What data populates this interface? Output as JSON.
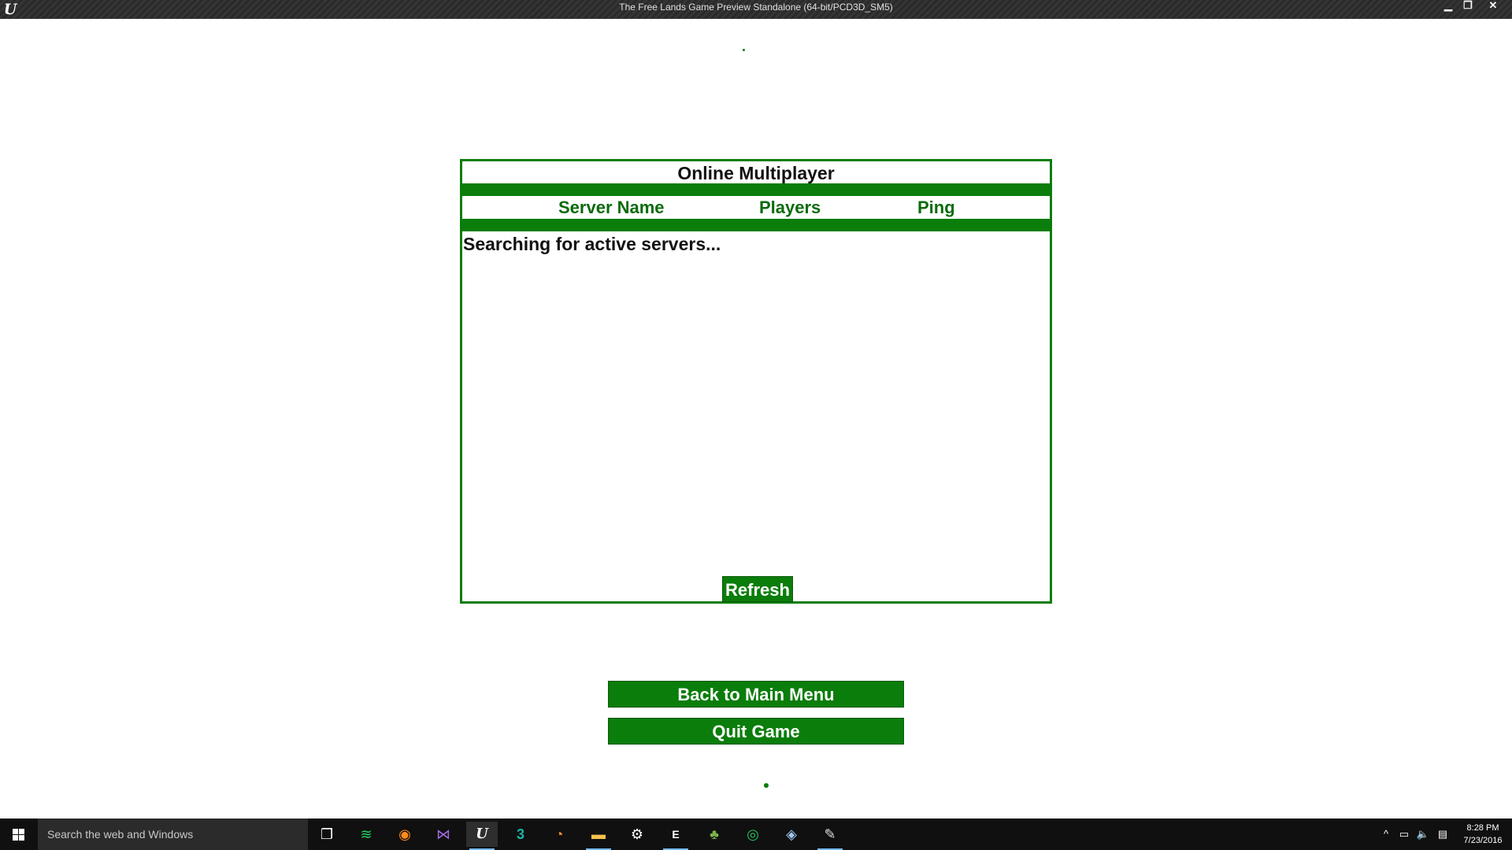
{
  "window": {
    "title": "The Free Lands Game Preview Standalone (64-bit/PCD3D_SM5)",
    "logo": "U",
    "controls": {
      "minimize": "▁",
      "maximize": "❐",
      "close": "✕"
    }
  },
  "panel": {
    "title": "Online Multiplayer",
    "columns": [
      "Server Name",
      "Players",
      "Ping"
    ],
    "status": "Searching for active servers...",
    "refresh_label": "Refresh"
  },
  "menu": {
    "back_label": "Back to Main Menu",
    "quit_label": "Quit Game"
  },
  "colors": {
    "accent": "#0b7d0b",
    "header_text": "#0b6b0b"
  },
  "taskbar": {
    "search_placeholder": "Search the web and Windows",
    "apps": [
      {
        "name": "task-view-icon",
        "glyph": "❐"
      },
      {
        "name": "spotify-icon",
        "glyph": "≋"
      },
      {
        "name": "firefox-icon",
        "glyph": "◉"
      },
      {
        "name": "visual-studio-icon",
        "glyph": "⋈"
      },
      {
        "name": "unreal-engine-icon",
        "glyph": "U"
      },
      {
        "name": "3ds-max-icon",
        "glyph": "3"
      },
      {
        "name": "blender-icon",
        "glyph": "◔"
      },
      {
        "name": "file-explorer-icon",
        "glyph": "▬"
      },
      {
        "name": "settings-gear-icon",
        "glyph": "⚙"
      },
      {
        "name": "epic-launcher-icon",
        "glyph": "E"
      },
      {
        "name": "tree-app-icon",
        "glyph": "♣"
      },
      {
        "name": "xbox-icon",
        "glyph": "◎"
      },
      {
        "name": "steam-icon",
        "glyph": "◈"
      },
      {
        "name": "paint-icon",
        "glyph": "✎"
      }
    ],
    "tray": {
      "chevron": "^",
      "network": "▭",
      "volume": "🔈",
      "notifications": "▤"
    },
    "clock": {
      "time": "8:28 PM",
      "date": "7/23/2016"
    }
  }
}
